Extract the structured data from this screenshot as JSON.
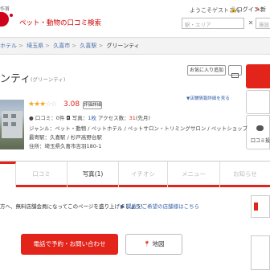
{
  "header": {
    "logo_small": "作首",
    "site_title": "ペット・動物の口コミ検索",
    "welcome": "ようこそゲストさん",
    "login": "ログイン",
    "signup": "新"
  },
  "search": {
    "station_placeholder": "駅・エリア",
    "clear": "✕",
    "keyword_placeholder": "施設・店名・ペ"
  },
  "breadcrumb": {
    "items": [
      "ホテル",
      "埼玉県",
      "久喜市",
      "久喜駅"
    ],
    "current": "グリーンティ"
  },
  "shop": {
    "name": "ンティ",
    "kana": "(グリーンティ)",
    "save_label": "お気に入り追加",
    "report_label": "▼店舗情報詳細を見る",
    "review_post_label": "口コミ投",
    "rating": {
      "stars_on": "★★★",
      "stars_off": "☆☆",
      "score": "3.08",
      "detail_label": "評価詳細"
    },
    "reviews_label": "口コミ：",
    "reviews_count": "0件",
    "photos_label": "写真：",
    "photos_count": "1枚",
    "access_label": "アクセス数：",
    "access_count": "31",
    "access_unit": "(先月)",
    "genre_label": "ジャンル：",
    "genres": "ペット・動物 / ペットホテル / ペットサロン・トリミングサロン / ペットショップ",
    "station_label": "最寄駅：",
    "stations": "久喜駅 / 杉戸高野台駅",
    "address_label": "住所：",
    "address": "埼玉県久喜市吉羽180-1"
  },
  "tabs": [
    {
      "label": "",
      "active": true
    },
    {
      "label": "口コミ"
    },
    {
      "label": "写真",
      "count": "(1)"
    },
    {
      "label": "イチオシ"
    },
    {
      "label": "メニュー"
    },
    {
      "label": "お知らせ"
    }
  ],
  "notice": {
    "text": "方へ、無料店舗会員になってこのページを盛り上げましょう！",
    "link": "▶ 掲載をご希望の店舗様はこちら"
  },
  "actions": {
    "call_label": "電話で予約・お問い合わせ",
    "map_label": "地図"
  },
  "colors": {
    "brand_red": "#e2241b",
    "link_blue": "#3a64a8",
    "star_gold": "#f5a623"
  }
}
